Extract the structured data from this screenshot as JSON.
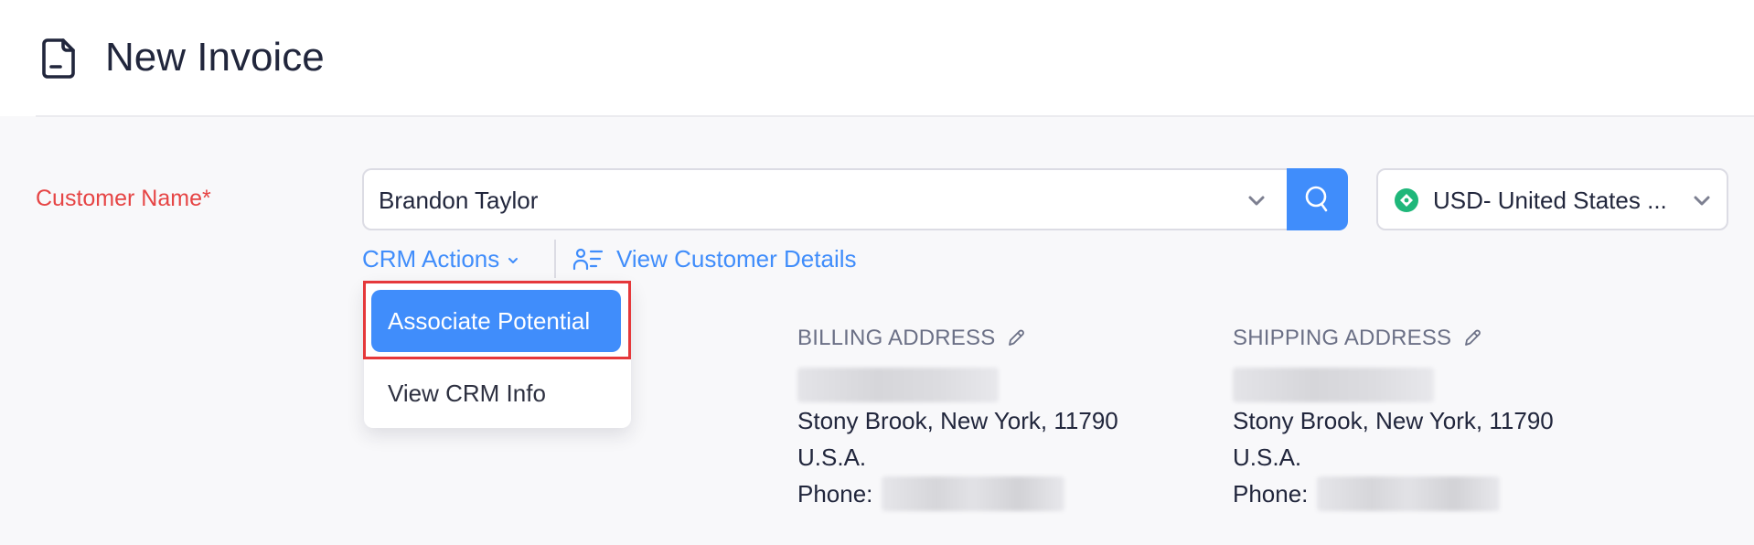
{
  "header": {
    "title": "New Invoice",
    "icon": "document-icon"
  },
  "form": {
    "customer_label": "Customer Name*",
    "customer_value": "Brandon Taylor",
    "customer_chevron_icon": "chevron-down-icon",
    "search_icon": "search-icon",
    "currency_value": "USD- United States ...",
    "currency_icon": "currency-icon",
    "currency_chevron_icon": "chevron-down-icon"
  },
  "actions": {
    "crm_actions_label": "CRM Actions",
    "view_customer_details_label": "View Customer Details"
  },
  "crm_menu": {
    "items": [
      {
        "label": "Associate Potential",
        "highlighted": true
      },
      {
        "label": "View CRM Info",
        "highlighted": false
      }
    ]
  },
  "billing_address": {
    "title": "BILLING ADDRESS",
    "line_redacted": true,
    "city_line": "Stony Brook, New York, 11790",
    "country": "U.S.A.",
    "phone_label": "Phone:",
    "phone_redacted": true
  },
  "shipping_address": {
    "title": "SHIPPING ADDRESS",
    "line_redacted": true,
    "city_line": "Stony Brook, New York, 11790",
    "country": "U.S.A.",
    "phone_label": "Phone:",
    "phone_redacted": true
  },
  "colors": {
    "accent": "#408dfb",
    "required_label": "#e64545",
    "highlight_border": "#e5383b",
    "currency_icon": "#1fb77a"
  }
}
